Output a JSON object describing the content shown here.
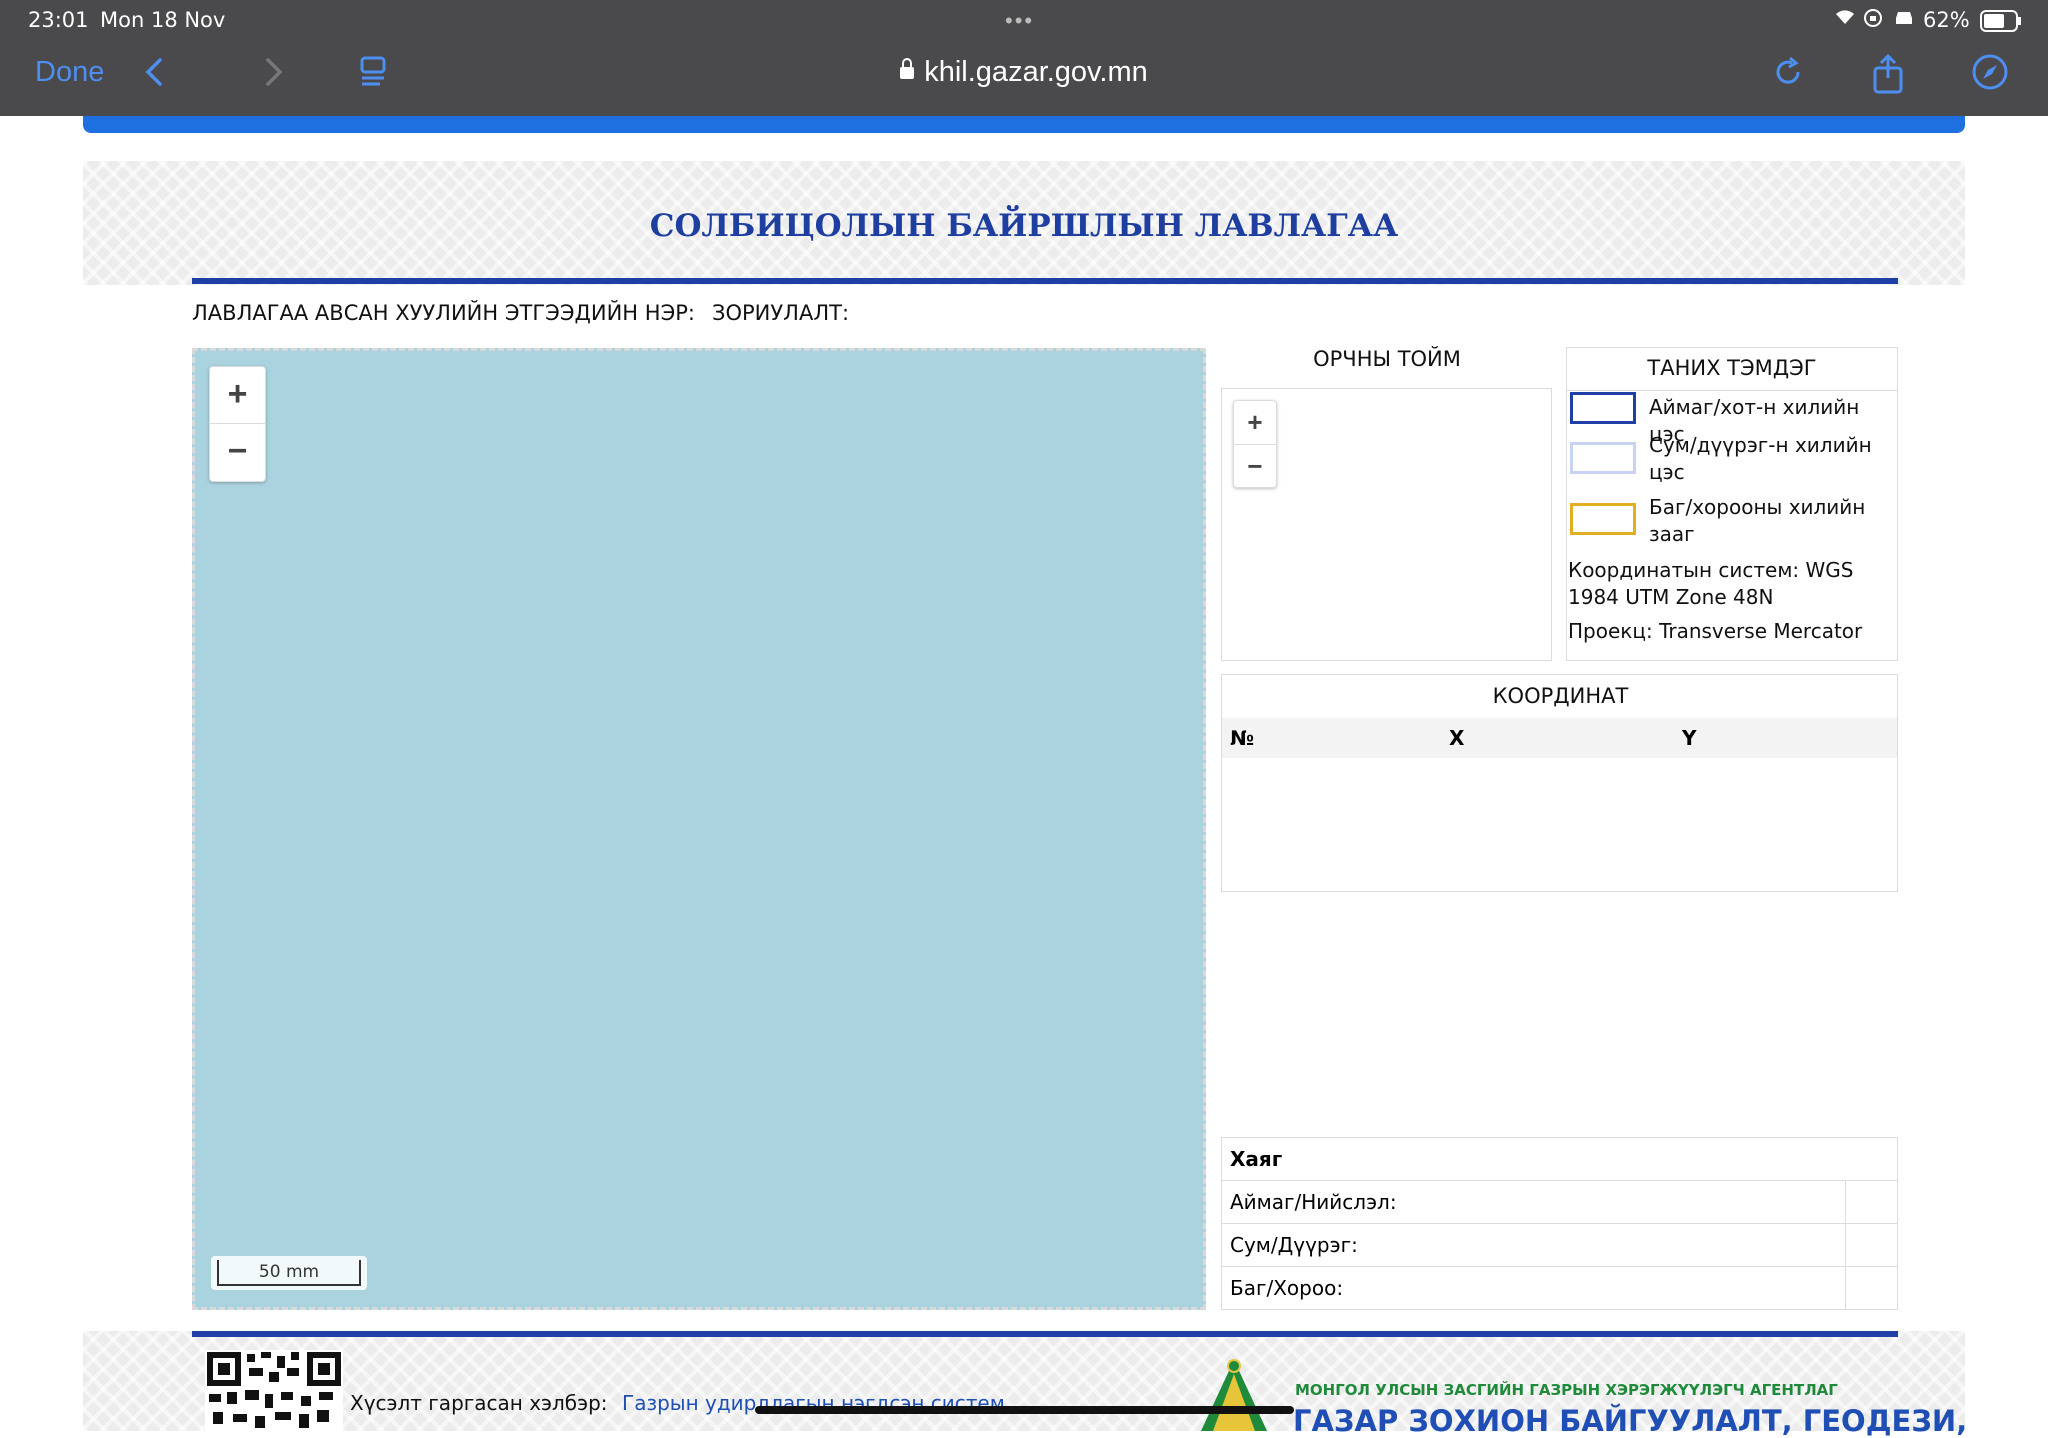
{
  "status_bar": {
    "time": "23:01",
    "date": "Mon 18 Nov",
    "battery": "62%"
  },
  "browser": {
    "done_label": "Done",
    "url": "khil.gazar.gov.mn"
  },
  "document": {
    "title": "СОЛБИЦОЛЫН БАЙРШЛЫН ЛАВЛАГАА",
    "requester_label": "ЛАВЛАГАА АВСАН ХУУЛИЙН ЭТГЭЭДИЙН НЭР:",
    "purpose_label": "ЗОРИУЛАЛТ:",
    "map": {
      "zoom_in": "+",
      "zoom_out": "−",
      "scale_label": "50 mm",
      "background_color": "#aad3df"
    },
    "overview": {
      "title": "ОРЧНЫ ТОЙМ",
      "zoom_in": "+",
      "zoom_out": "−"
    },
    "legend": {
      "title": "ТАНИХ ТЭМДЭГ",
      "items": [
        {
          "line1": "Аймаг/хот-н хилийн цэс",
          "line2": "",
          "color": "#1f3fa6"
        },
        {
          "line1": "Сум/дүүрэг-н хилийн",
          "line2": "цэс",
          "color": "#c7d3f0"
        },
        {
          "line1": "Баг/хорооны хилийн",
          "line2": "зааг",
          "color": "#e0b020"
        }
      ],
      "coord_system_line1": "Координатын систем: WGS",
      "coord_system_line2": "1984 UTM Zone 48N",
      "projection": "Проекц: Transverse Mercator"
    },
    "coordinates": {
      "title": "КООРДИНАТ",
      "col_no": "№",
      "col_x": "X",
      "col_y": "Y"
    },
    "address": {
      "title": "Хаяг",
      "rows": [
        "Аймаг/Нийслэл:",
        "Сум/Дүүрэг:",
        "Баг/Хороо:"
      ]
    },
    "footer": {
      "request_label": "Хүсэлт гаргасан хэлбэр:",
      "request_value": "Газрын удирдлагын нэгдсэн систем",
      "agency_line1": "МОНГОЛ УЛСЫН ЗАСГИЙН ГАЗРЫН ХЭРЭГЖҮҮЛЭГЧ АГЕНТЛАГ",
      "agency_line2": "ГАЗАР ЗОХИОН БАЙГУУЛАЛТ, ГЕОДЕЗИ,"
    }
  }
}
